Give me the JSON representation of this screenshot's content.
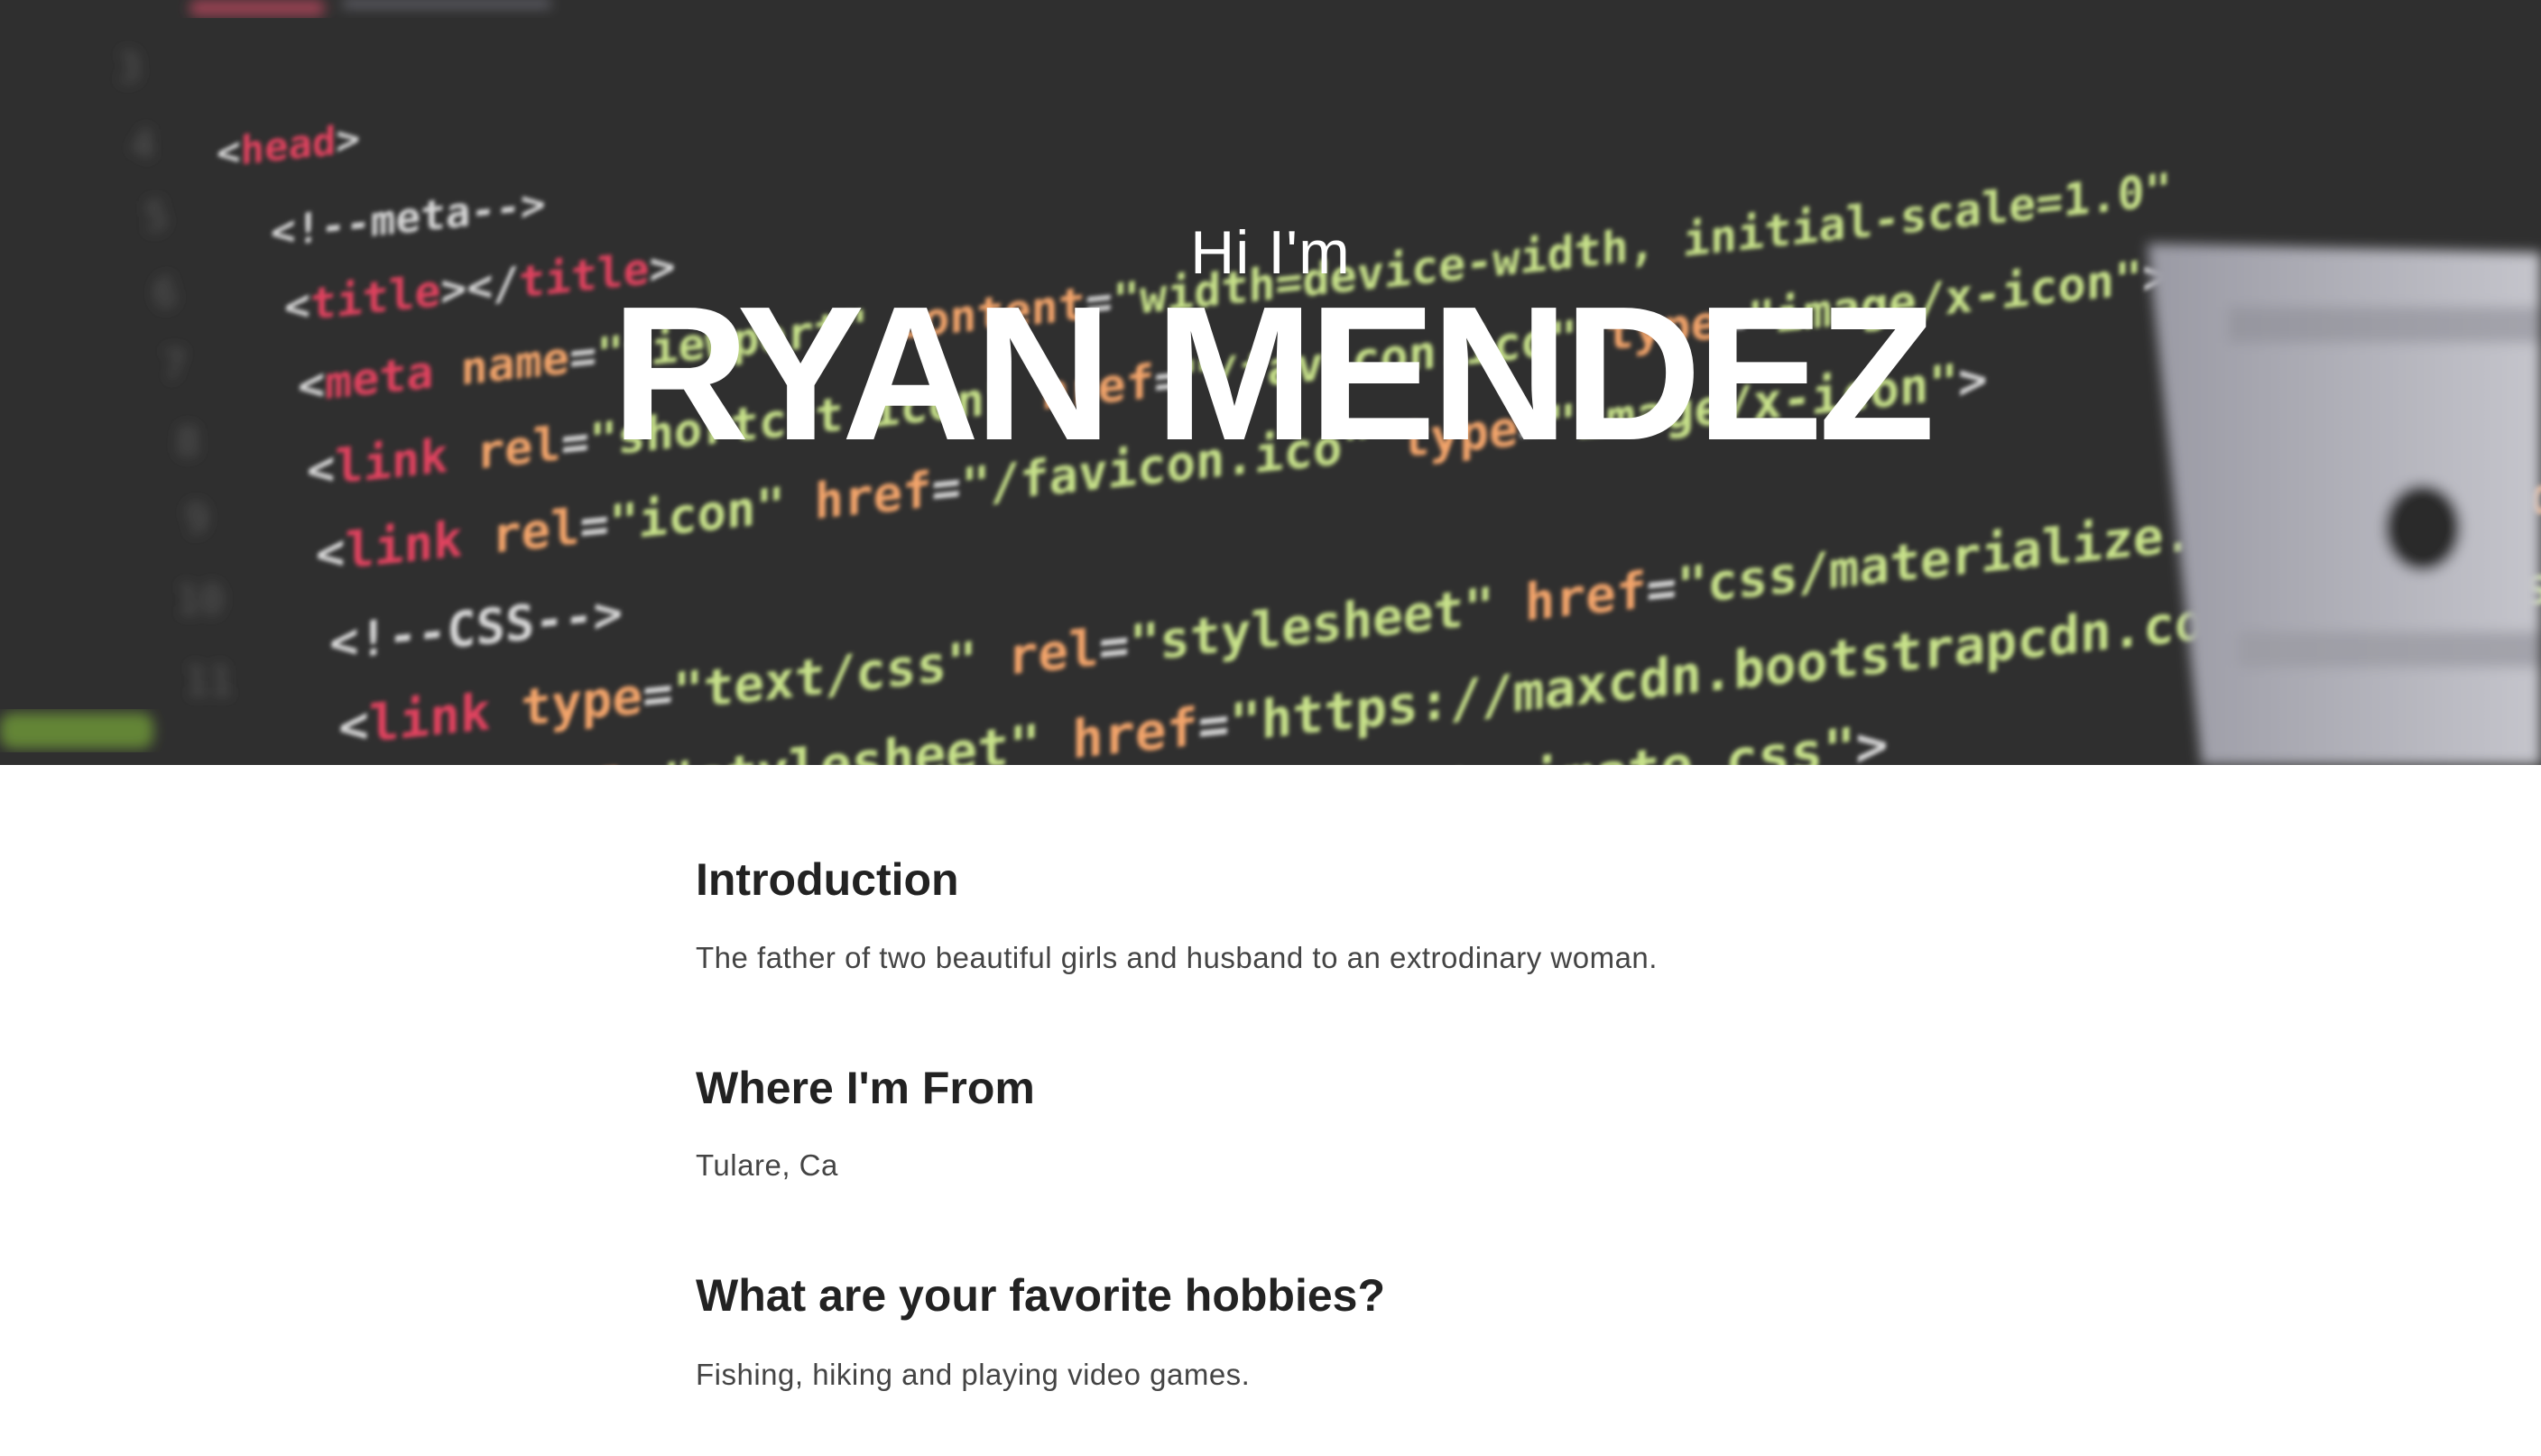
{
  "hero": {
    "greeting": "Hi I'm",
    "name": "RYAN MENDEZ"
  },
  "sections": [
    {
      "title": "Introduction",
      "text": "The father of two beautiful girls and husband to an extrodinary woman."
    },
    {
      "title": "Where I'm From",
      "text": "Tulare, Ca"
    },
    {
      "title": "What are your favorite hobbies?",
      "text": "Fishing, hiking and playing video games."
    }
  ],
  "colors": {
    "hero_background": "#2e2e2e",
    "heading": "#222222",
    "body_text": "#444444"
  }
}
